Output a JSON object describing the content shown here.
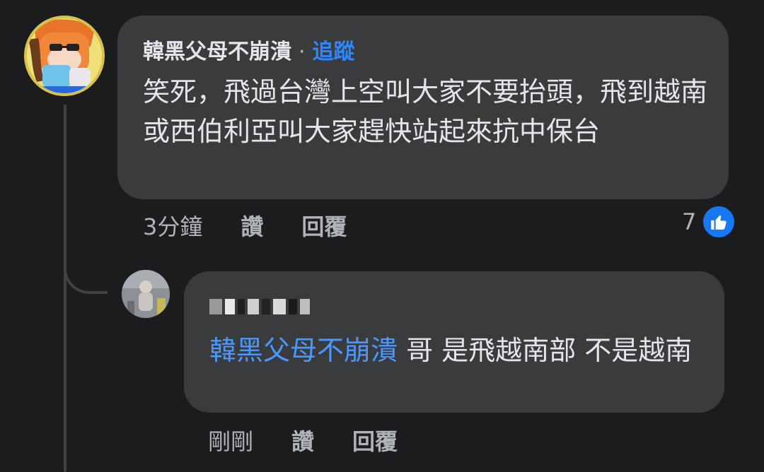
{
  "main_comment": {
    "author": "韓黑父母不崩潰",
    "separator": "·",
    "follow_label": "追蹤",
    "text": "笑死，飛過台灣上空叫大家不要抬頭，飛到越南或西伯利亞叫大家趕快站起來抗中保台",
    "time": "3分鐘",
    "like_label": "讚",
    "reply_label": "回覆",
    "reaction_count": "7",
    "reaction_icon": "thumbs-up-icon"
  },
  "reply_comment": {
    "mention": "韓黑父母不崩潰",
    "text": " 哥 是飛越南部 不是越南",
    "time": "剛剛",
    "like_label": "讚",
    "reply_label": "回覆"
  },
  "colors": {
    "background": "#1b1c1e",
    "bubble": "#3a3b3c",
    "link_blue": "#2d88ff",
    "like_blue": "#1877f2"
  }
}
